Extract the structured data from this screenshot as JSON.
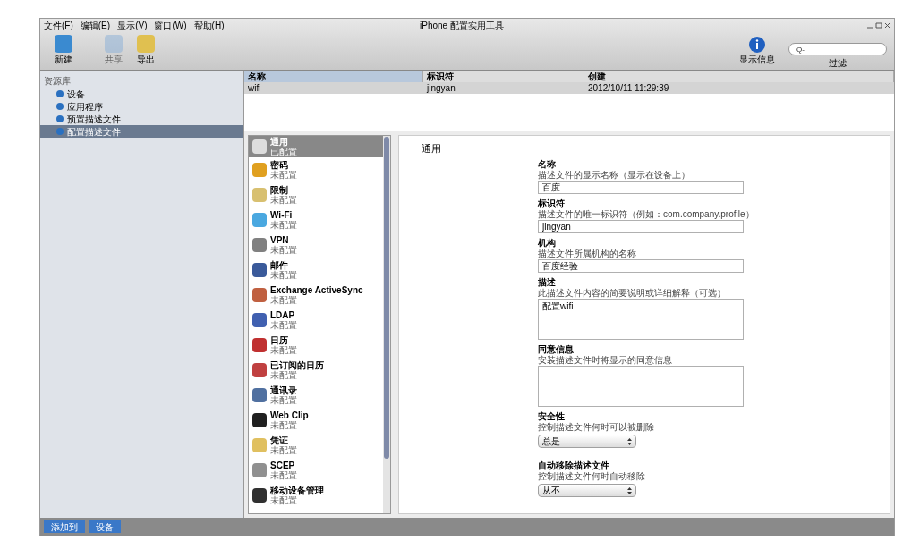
{
  "window": {
    "title": "iPhone 配置实用工具"
  },
  "menu": [
    "文件(F)",
    "编辑(E)",
    "显示(V)",
    "窗口(W)",
    "帮助(H)"
  ],
  "toolbar": {
    "left": [
      {
        "label": "新建",
        "disabled": false
      },
      {
        "label": "共享",
        "disabled": true
      },
      {
        "label": "导出",
        "disabled": false
      }
    ],
    "right": {
      "label": "显示信息"
    },
    "search": {
      "placeholder": "Q-",
      "label": "过滤"
    }
  },
  "sidebar": {
    "header": "资源库",
    "items": [
      {
        "label": "设备",
        "selected": false
      },
      {
        "label": "应用程序",
        "selected": false
      },
      {
        "label": "预置描述文件",
        "selected": false
      },
      {
        "label": "配置描述文件",
        "selected": true
      }
    ]
  },
  "table": {
    "columns": [
      "名称",
      "标识符",
      "创建"
    ],
    "rows": [
      {
        "cells": [
          "wifi",
          "jingyan",
          "2012/10/11 11:29:39"
        ],
        "selected": true
      }
    ]
  },
  "payloads": {
    "header": {
      "title": "通用",
      "subtitle": "已配置"
    },
    "items": [
      {
        "title": "密码",
        "status": "未配置",
        "color": "#e0a020"
      },
      {
        "title": "限制",
        "status": "未配置",
        "color": "#d8c070"
      },
      {
        "title": "Wi-Fi",
        "status": "未配置",
        "color": "#4aa8e0"
      },
      {
        "title": "VPN",
        "status": "未配置",
        "color": "#808080"
      },
      {
        "title": "邮件",
        "status": "未配置",
        "color": "#3a5a9a"
      },
      {
        "title": "Exchange ActiveSync",
        "status": "未配置",
        "color": "#c06040"
      },
      {
        "title": "LDAP",
        "status": "未配置",
        "color": "#4060b0"
      },
      {
        "title": "日历",
        "status": "未配置",
        "color": "#c03030"
      },
      {
        "title": "已订阅的日历",
        "status": "未配置",
        "color": "#c04040"
      },
      {
        "title": "通讯录",
        "status": "未配置",
        "color": "#5070a0"
      },
      {
        "title": "Web Clip",
        "status": "未配置",
        "color": "#202020"
      },
      {
        "title": "凭证",
        "status": "未配置",
        "color": "#e0c060"
      },
      {
        "title": "SCEP",
        "status": "未配置",
        "color": "#909090"
      },
      {
        "title": "移动设备管理",
        "status": "未配置",
        "color": "#303030"
      }
    ]
  },
  "form": {
    "title": "通用",
    "fields": [
      {
        "kind": "text",
        "label": "名称",
        "hint": "描述文件的显示名称（显示在设备上）",
        "value": "百度"
      },
      {
        "kind": "text",
        "label": "标识符",
        "hint": "描述文件的唯一标识符（例如：com.company.profile）",
        "value": "jingyan"
      },
      {
        "kind": "text",
        "label": "机构",
        "hint": "描述文件所属机构的名称",
        "value": "百度经验"
      },
      {
        "kind": "area",
        "label": "描述",
        "hint": "此描述文件内容的简要说明或详细解释（可选）",
        "value": "配置wifi"
      },
      {
        "kind": "area",
        "label": "同意信息",
        "hint": "安装描述文件时将显示的同意信息"
      },
      {
        "kind": "select",
        "label": "安全性",
        "hint": "控制描述文件何时可以被删除",
        "value": "总是"
      },
      {
        "kind": "select",
        "label": "自动移除描述文件",
        "hint": "控制描述文件何时自动移除",
        "value": "从不"
      }
    ]
  },
  "status_bar": {
    "buttons": [
      "添加到",
      "设备"
    ]
  }
}
